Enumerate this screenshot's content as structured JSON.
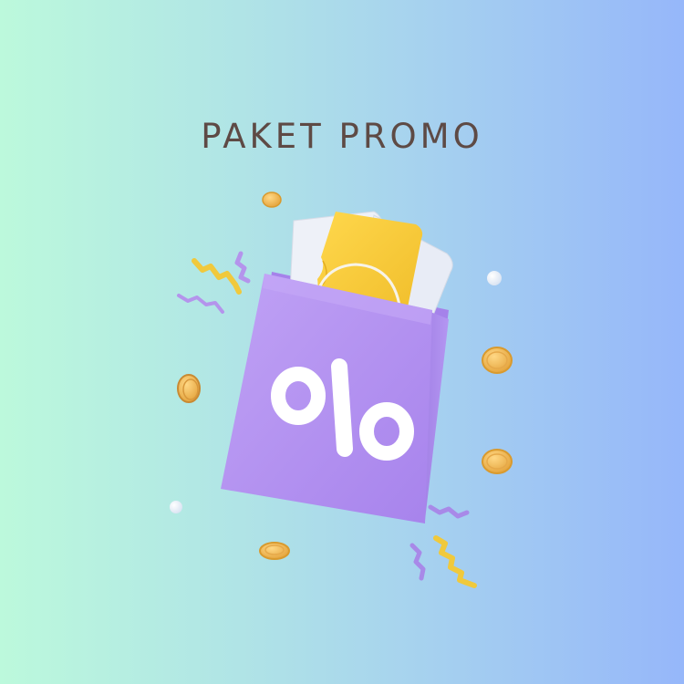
{
  "banner": {
    "title": "PAKET PROMO",
    "colors": {
      "background_left": "#bcf9dc",
      "background_right": "#96b7fa",
      "title_text": "#5e4a45",
      "bag": "#b08ff0",
      "ticket": "#f6cb3a",
      "coin": "#e9ae3f"
    },
    "illustration": {
      "icon": "shopping-bag-percent-icon",
      "symbol": "percent-icon",
      "decorations": [
        "coin-icon",
        "confetti-icon",
        "pearl-icon",
        "ticket-icon"
      ]
    }
  }
}
